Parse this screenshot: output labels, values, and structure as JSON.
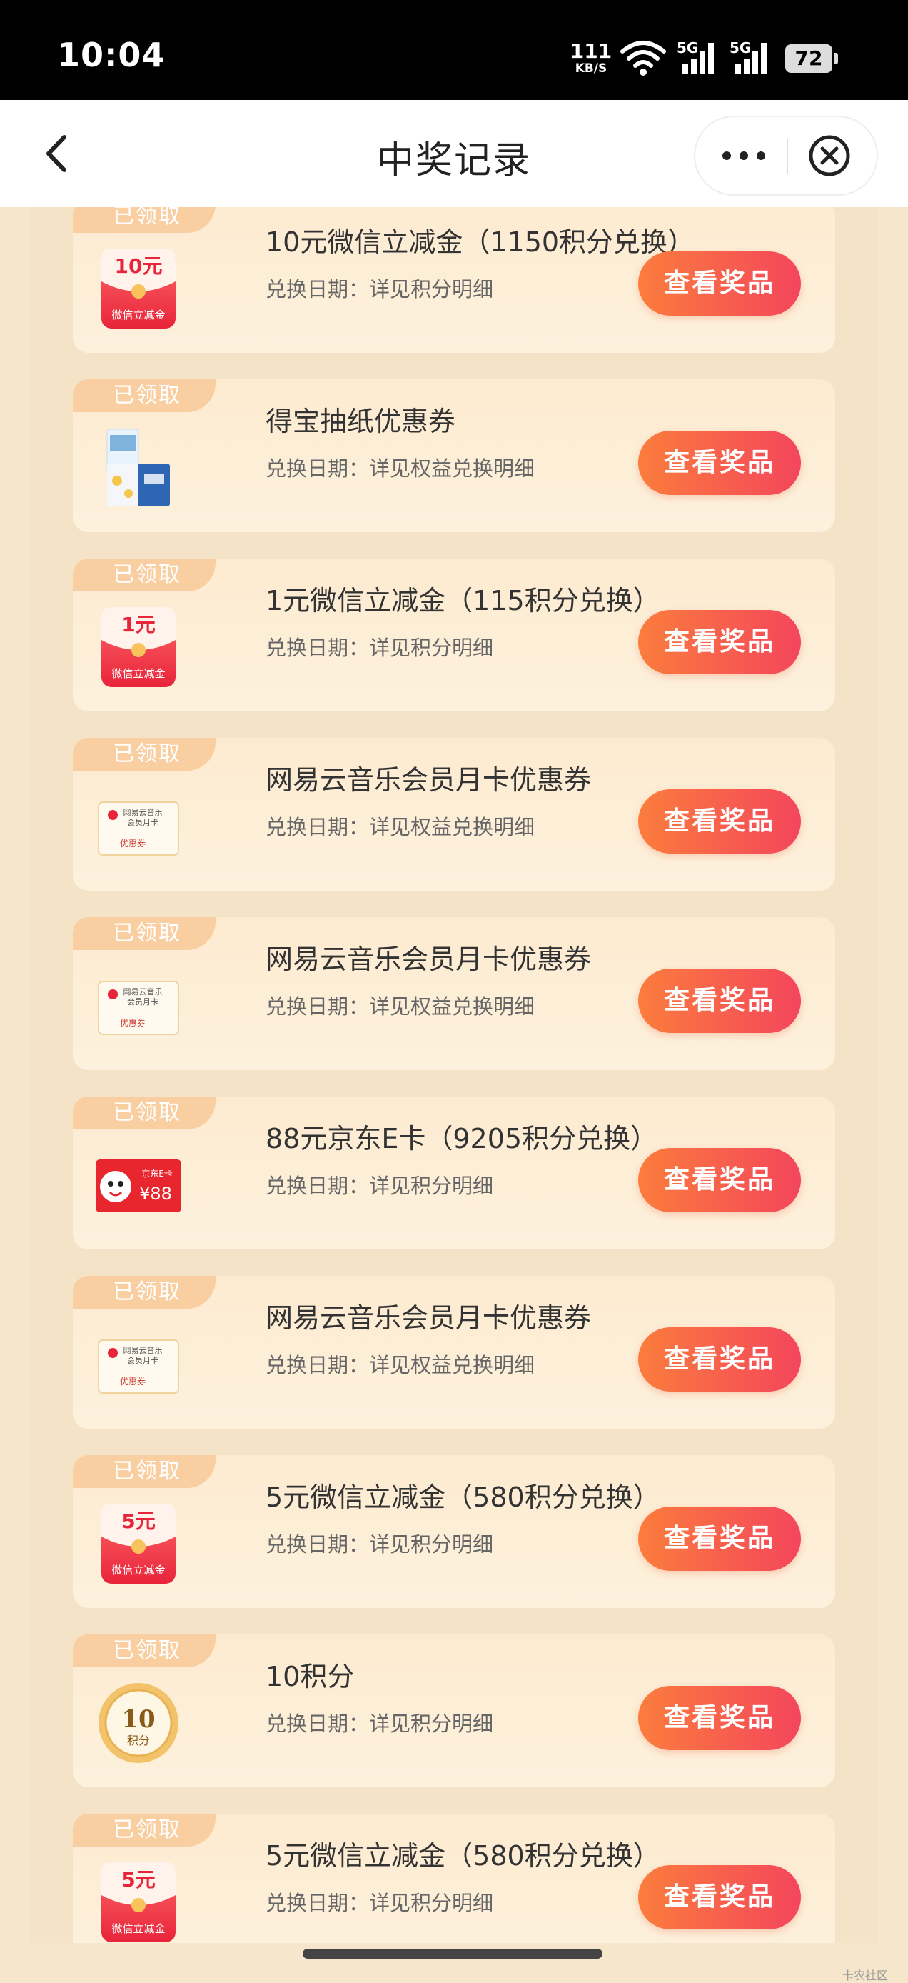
{
  "status": {
    "time": "10:04",
    "net_speed": "111",
    "net_unit": "KB/S",
    "battery": "72"
  },
  "header": {
    "title": "中奖记录"
  },
  "colors": {
    "button_start": "#fb7d3d",
    "button_end": "#f4465c",
    "tag": "#f9cfa2",
    "card": "#fdebd0"
  },
  "records": [
    {
      "tag": "已领取",
      "icon": "red-packet-icon",
      "amount": "10元",
      "sub": "微信立减金",
      "title": "10元微信立减金（1150积分兑换）",
      "date": "兑换日期：详见积分明细",
      "button": "查看奖品"
    },
    {
      "tag": "已领取",
      "icon": "tissue-box-icon",
      "title": "得宝抽纸优惠券",
      "date": "兑换日期：详见权益兑换明细",
      "button": "查看奖品"
    },
    {
      "tag": "已领取",
      "icon": "red-packet-icon",
      "amount": "1元",
      "sub": "微信立减金",
      "title": "1元微信立减金（115积分兑换）",
      "date": "兑换日期：详见积分明细",
      "button": "查看奖品"
    },
    {
      "tag": "已领取",
      "icon": "music-coupon-icon",
      "coupon_l1": "网易云音乐",
      "coupon_l2": "会员月卡",
      "coupon_l3": "优惠券",
      "title": "网易云音乐会员月卡优惠券",
      "date": "兑换日期：详见权益兑换明细",
      "button": "查看奖品"
    },
    {
      "tag": "已领取",
      "icon": "music-coupon-icon",
      "coupon_l1": "网易云音乐",
      "coupon_l2": "会员月卡",
      "coupon_l3": "优惠券",
      "title": "网易云音乐会员月卡优惠券",
      "date": "兑换日期：详见权益兑换明细",
      "button": "查看奖品"
    },
    {
      "tag": "已领取",
      "icon": "jd-ecard-icon",
      "card_label": "京东E卡",
      "card_amount": "¥88",
      "title": "88元京东E卡（9205积分兑换）",
      "date": "兑换日期：详见积分明细",
      "button": "查看奖品"
    },
    {
      "tag": "已领取",
      "icon": "music-coupon-icon",
      "coupon_l1": "网易云音乐",
      "coupon_l2": "会员月卡",
      "coupon_l3": "优惠券",
      "title": "网易云音乐会员月卡优惠券",
      "date": "兑换日期：详见权益兑换明细",
      "button": "查看奖品"
    },
    {
      "tag": "已领取",
      "icon": "red-packet-icon",
      "amount": "5元",
      "sub": "微信立减金",
      "title": "5元微信立减金（580积分兑换）",
      "date": "兑换日期：详见积分明细",
      "button": "查看奖品"
    },
    {
      "tag": "已领取",
      "icon": "points-coin-icon",
      "coin_num": "10",
      "coin_unit": "积分",
      "title": "10积分",
      "date": "兑换日期：详见积分明细",
      "button": "查看奖品"
    },
    {
      "tag": "已领取",
      "icon": "red-packet-icon",
      "amount": "5元",
      "sub": "微信立减金",
      "title": "5元微信立减金（580积分兑换）",
      "date": "兑换日期：详见积分明细",
      "button": "查看奖品"
    }
  ],
  "watermark": "卡农社区"
}
